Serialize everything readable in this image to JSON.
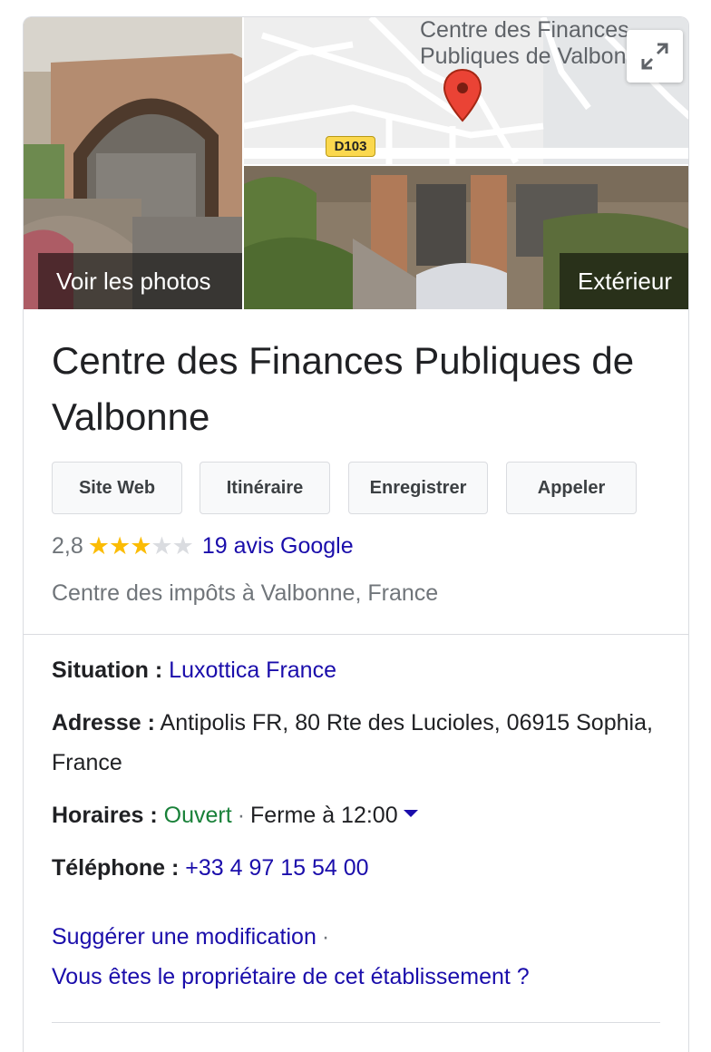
{
  "photos": {
    "main_label": "Voir les photos",
    "exterior_label": "Extérieur"
  },
  "map": {
    "place_label": "Centre des Finances\nPubliques de Valbonne",
    "road_label": "D103"
  },
  "place": {
    "title": "Centre des Finances Publiques de Valbonne"
  },
  "actions": {
    "website": "Site Web",
    "directions": "Itinéraire",
    "save": "Enregistrer",
    "call": "Appeler"
  },
  "rating": {
    "value": "2,8",
    "stars": 2.8,
    "reviews_link": "19 avis Google",
    "colors": {
      "star_filled": "#fbbc04",
      "star_empty": "#dadce0"
    }
  },
  "category": "Centre des impôts à Valbonne, France",
  "details": {
    "located_in_label": "Situation :",
    "located_in_value": "Luxottica France",
    "address_label": "Adresse :",
    "address_value": "Antipolis FR, 80 Rte des Lucioles, 06915 Sophia, France",
    "hours_label": "Horaires :",
    "hours_status": "Ouvert",
    "hours_separator": "·",
    "hours_detail": "Ferme à 12:00",
    "phone_label": "Téléphone :",
    "phone_value": "+33 4 97 15 54 00"
  },
  "footer": {
    "suggest_edit": "Suggérer une modification",
    "separator": "·",
    "owner_question": "Vous êtes le propriétaire de cet établissement ?"
  },
  "colors": {
    "link": "#1a0dab",
    "open_status": "#188038",
    "map_pin": "#ea4335"
  }
}
